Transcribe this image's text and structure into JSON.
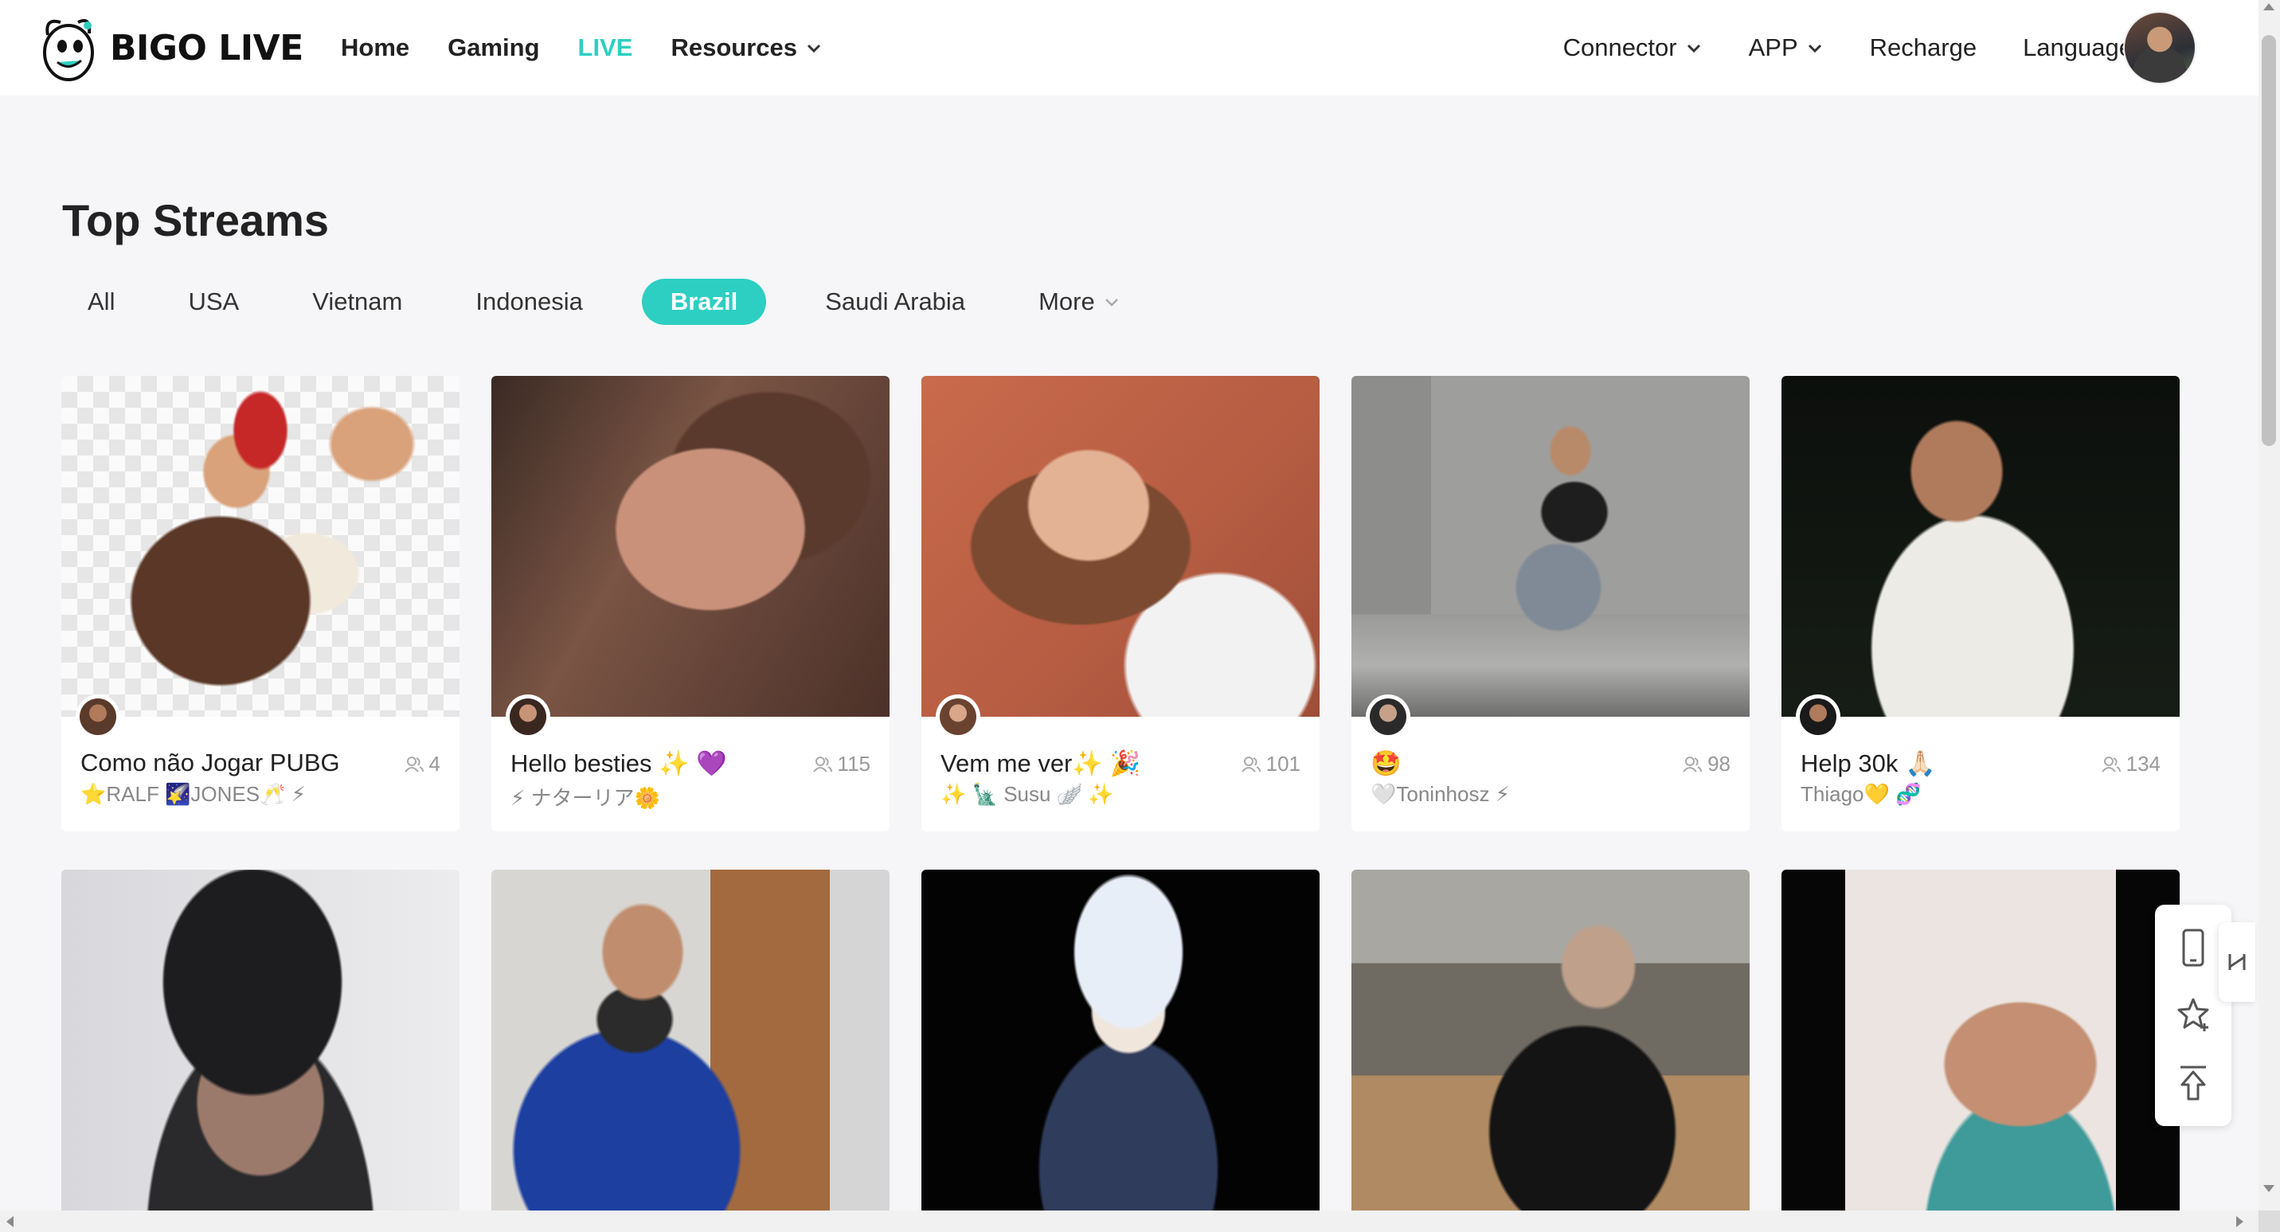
{
  "header": {
    "logo_text": "BIGO LIVE",
    "nav_left": [
      {
        "label": "Home",
        "active": false,
        "dropdown": false
      },
      {
        "label": "Gaming",
        "active": false,
        "dropdown": false
      },
      {
        "label": "LIVE",
        "active": true,
        "dropdown": false
      },
      {
        "label": "Resources",
        "active": false,
        "dropdown": true
      }
    ],
    "nav_right": [
      {
        "label": "Connector",
        "dropdown": true
      },
      {
        "label": "APP",
        "dropdown": true
      },
      {
        "label": "Recharge",
        "dropdown": false
      },
      {
        "label": "Language",
        "dropdown": false
      }
    ],
    "accent_color": "#2ccfc2"
  },
  "main": {
    "title": "Top Streams",
    "tabs": [
      {
        "label": "All",
        "active": false
      },
      {
        "label": "USA",
        "active": false
      },
      {
        "label": "Vietnam",
        "active": false
      },
      {
        "label": "Indonesia",
        "active": false
      },
      {
        "label": "Brazil",
        "active": true
      },
      {
        "label": "Saudi Arabia",
        "active": false
      },
      {
        "label": "More",
        "active": false
      }
    ],
    "streams_row1": [
      {
        "title": "Como não Jogar PUBG",
        "host": "⭐RALF 🌠JONES🥂 ⚡",
        "viewers": "4"
      },
      {
        "title": "Hello besties ✨ 💜",
        "host": "⚡ ナターリア🌼",
        "viewers": "115"
      },
      {
        "title": "Vem me ver✨ 🎉",
        "host": "✨ 🗽 Susu 🪽 ✨",
        "viewers": "101"
      },
      {
        "title": "🤩",
        "host": "🤍Toninhosz ⚡",
        "viewers": "98"
      },
      {
        "title": "Help 30k 🙏🏻",
        "host": "Thiago💛 🧬",
        "viewers": "134"
      }
    ]
  },
  "side_toolbar": {
    "icons": [
      "phone-icon",
      "star-plus-icon",
      "back-to-top-icon"
    ]
  }
}
